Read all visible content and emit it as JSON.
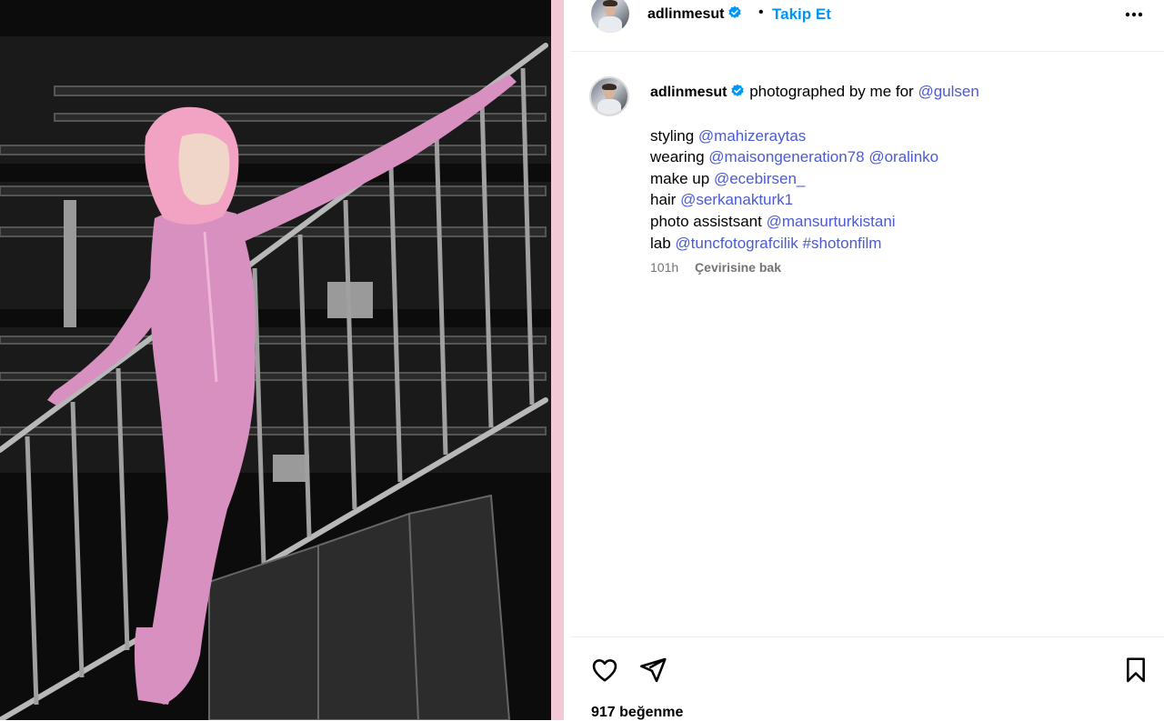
{
  "post": {
    "username": "adlinmesut",
    "separator": "•",
    "follow_label": "Takip Et"
  },
  "caption": {
    "username": "adlinmesut",
    "text": "photographed by me for",
    "mention_main": "@gulsen",
    "lines": [
      {
        "prefix": "styling",
        "mentions": [
          "@mahizeraytas"
        ]
      },
      {
        "prefix": "wearing",
        "mentions": [
          "@maisongeneration78",
          "@oralinko"
        ]
      },
      {
        "prefix": "make up",
        "mentions": [
          "@ecebirsen_"
        ]
      },
      {
        "prefix": "hair",
        "mentions": [
          "@serkanakturk1"
        ]
      },
      {
        "prefix": "photo assistsant",
        "mentions": [
          "@mansurturkistani"
        ]
      },
      {
        "prefix": "lab",
        "mentions": [
          "@tuncfotografcilik",
          "#shotonfilm"
        ]
      }
    ],
    "time_ago": "101h",
    "translate_label": "Çevirisine bak"
  },
  "actions": {
    "like_icon": "heart-icon",
    "share_icon": "send-icon",
    "save_icon": "bookmark-icon",
    "likes_text": "917 beğenme"
  },
  "colors": {
    "accent": "#0095f6",
    "mention": "#4a5bd4",
    "verified": "#0095f6"
  }
}
